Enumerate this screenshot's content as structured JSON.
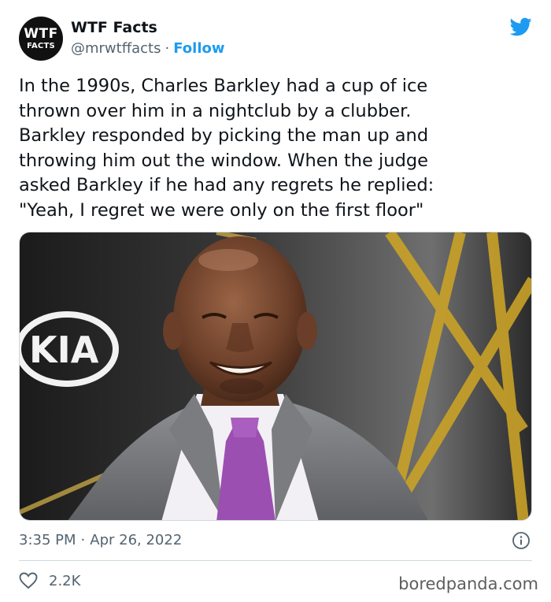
{
  "account": {
    "avatar_line1": "WTF",
    "avatar_line2": "FACTS",
    "name": "WTF Facts",
    "handle": "@mrwtffacts",
    "separator": "·",
    "follow_label": "Follow"
  },
  "tweet": {
    "text": "In the 1990s, Charles Barkley had a cup of ice\nthrown over him in a nightclub by a clubber.\nBarkley responded by picking the man up and\nthrowing him out the window. When the judge\nasked Barkley if he had any regrets he replied:\n\"Yeah, I regret we were only on the first floor\"",
    "time": "3:35 PM",
    "separator": "·",
    "date": "Apr 26, 2022",
    "likes": "2.2K"
  },
  "photo": {
    "backdrop_logo": "KIA"
  },
  "colors": {
    "brand_blue": "#1d9bf0",
    "text_primary": "#0f1419",
    "text_secondary": "#536471",
    "divider": "#cfd9de"
  },
  "icons": {
    "platform": "twitter-bird-icon",
    "info": "info-icon",
    "like": "heart-outline-icon"
  },
  "watermark": "boredpanda.com"
}
